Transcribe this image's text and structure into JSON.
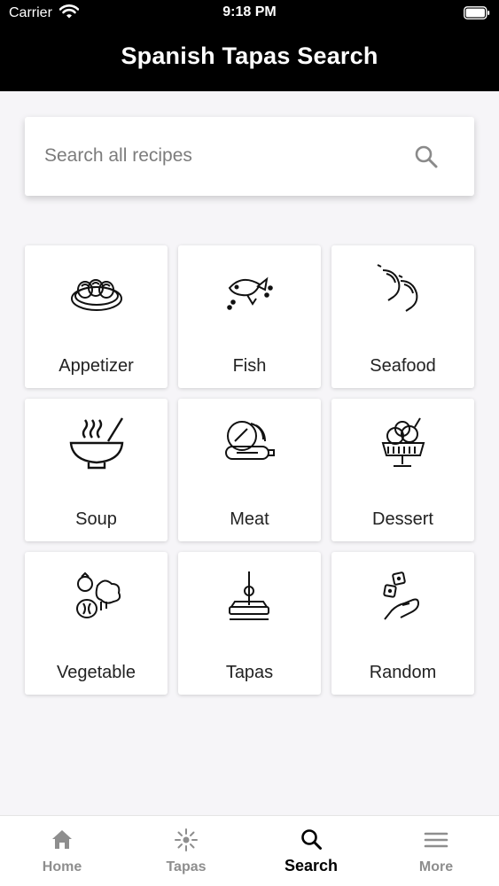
{
  "status_bar": {
    "carrier": "Carrier",
    "time": "9:18 PM"
  },
  "header": {
    "title": "Spanish Tapas Search"
  },
  "search": {
    "placeholder": "Search all recipes",
    "value": "",
    "icon": "search-icon"
  },
  "categories": [
    {
      "label": "Appetizer",
      "icon": "appetizer-platter-icon"
    },
    {
      "label": "Fish",
      "icon": "fish-icon"
    },
    {
      "label": "Seafood",
      "icon": "shrimp-icon"
    },
    {
      "label": "Soup",
      "icon": "soup-bowl-icon"
    },
    {
      "label": "Meat",
      "icon": "ham-icon"
    },
    {
      "label": "Dessert",
      "icon": "ice-cream-sundae-icon"
    },
    {
      "label": "Vegetable",
      "icon": "vegetables-icon"
    },
    {
      "label": "Tapas",
      "icon": "tapa-skewer-icon"
    },
    {
      "label": "Random",
      "icon": "dice-hand-icon"
    }
  ],
  "tabbar": {
    "tabs": [
      {
        "label": "Home",
        "icon": "home-icon",
        "active": false
      },
      {
        "label": "Tapas",
        "icon": "sparkle-icon",
        "active": false
      },
      {
        "label": "Search",
        "icon": "search-icon",
        "active": true
      },
      {
        "label": "More",
        "icon": "menu-icon",
        "active": false
      }
    ]
  },
  "colors": {
    "header_bg": "#000000",
    "page_bg": "#f6f5f8",
    "tab_inactive": "#8e8e8e",
    "tab_active": "#000000"
  }
}
